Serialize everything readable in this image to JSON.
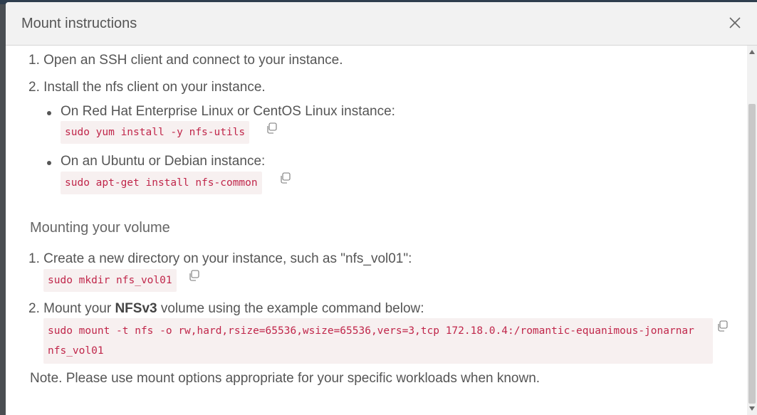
{
  "modal": {
    "title": "Mount instructions"
  },
  "install": {
    "step1": "1. Open an SSH client and connect to your instance.",
    "step2": "2. Install the nfs client on your instance.",
    "rhel_label": "On Red Hat Enterprise Linux or CentOS Linux instance:",
    "rhel_cmd": "sudo yum install -y nfs-utils",
    "ubuntu_label": "On an Ubuntu or Debian instance:",
    "ubuntu_cmd": "sudo apt-get install nfs-common"
  },
  "mounting": {
    "heading": "Mounting your volume",
    "step1": "1. Create a new directory on your instance, such as \"nfs_vol01\":",
    "mkdir_cmd": "sudo mkdir nfs_vol01",
    "step2_prefix": "2. Mount your ",
    "step2_bold": "NFSv3",
    "step2_suffix": " volume using the example command below:",
    "mount_cmd": "sudo mount -t nfs -o rw,hard,rsize=65536,wsize=65536,vers=3,tcp 172.18.0.4:/romantic-equanimous-jonarnar nfs_vol01",
    "note": "Note. Please use mount options appropriate for your specific workloads when known."
  },
  "icons": {
    "close": "close-icon",
    "copy": "copy-icon"
  }
}
